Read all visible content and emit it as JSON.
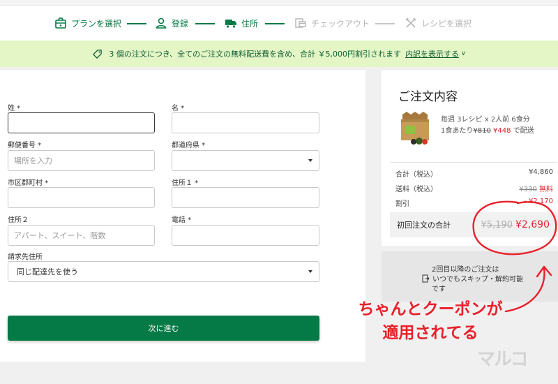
{
  "steps": [
    {
      "label": "プランを選択"
    },
    {
      "label": "登録"
    },
    {
      "label": "住所"
    },
    {
      "label": "チェックアウト"
    },
    {
      "label": "レシピを選択"
    }
  ],
  "banner": {
    "text": "3 個の注文につき、全てのご注文の無料配送費を含め、合計 ￥5,000円割引されます",
    "link": "内訳を表示する"
  },
  "form": {
    "last_name_label": "姓 *",
    "first_name_label": "名 *",
    "postal_label": "郵便番号 *",
    "postal_placeholder": "場所を入力",
    "prefecture_label": "都道府県 *",
    "city_label": "市区郡町村 *",
    "address1_label": "住所１ *",
    "address2_label": "住所２",
    "address2_placeholder": "アパート、スイート、階数",
    "phone_label": "電話 *",
    "billing_label": "請求先住所",
    "billing_value": "同じ配達先を使う",
    "next_button": "次に進む"
  },
  "summary": {
    "title": "ご注文内容",
    "plan_line1": "毎週 3レシピ x 2人前 6食分",
    "plan_line2_prefix": "1食あたり",
    "plan_old_price": "¥810",
    "plan_new_price": "¥448",
    "plan_line2_suffix": "で配送",
    "subtotal_label": "合計（税込）",
    "subtotal_value": "¥4,860",
    "shipping_label": "送料（税込）",
    "shipping_old": "¥330",
    "shipping_free": "無料",
    "discount_label": "割引",
    "discount_value": "- ¥2,170",
    "first_total_label": "初回注文の合計",
    "first_total_old": "¥5,190",
    "first_total_new": "¥2,690"
  },
  "notice": {
    "line1": "2回目以降のご注文は",
    "line2": "いつでもスキップ・解約可能",
    "line3": "です"
  },
  "annotation": {
    "line1": "ちゃんとクーポンが",
    "line2": "適用されてる"
  },
  "watermark": "マルコ",
  "colors": {
    "brand_green": "#067a46",
    "banner_bg": "#e4f5c6",
    "price_red": "#e0232c",
    "annotation_red": "#e8202a"
  },
  "icons": [
    "plan-box-icon",
    "user-icon",
    "truck-icon",
    "checkout-card-icon",
    "utensils-icon",
    "tag-icon",
    "chevron-down-icon",
    "document-icon"
  ]
}
